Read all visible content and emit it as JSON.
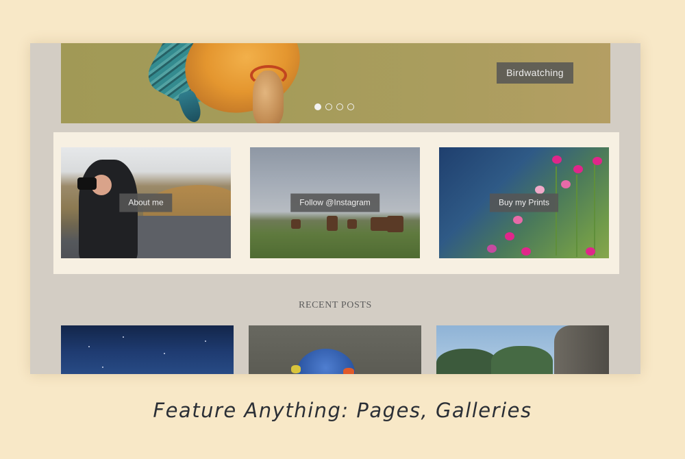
{
  "hero": {
    "caption": "Birdwatching",
    "slides": 4,
    "active_slide": 1
  },
  "features": [
    {
      "label": "About me"
    },
    {
      "label": "Follow @Instagram"
    },
    {
      "label": "Buy my Prints"
    }
  ],
  "recent_posts": {
    "title": "RECENT POSTS"
  },
  "tagline": "Feature Anything: Pages, Galleries",
  "colors": {
    "page_bg": "#f8e8c7",
    "frame_bg": "#d3cdc4",
    "feature_band_bg": "#f7f0e2",
    "label_bg": "#555555"
  }
}
